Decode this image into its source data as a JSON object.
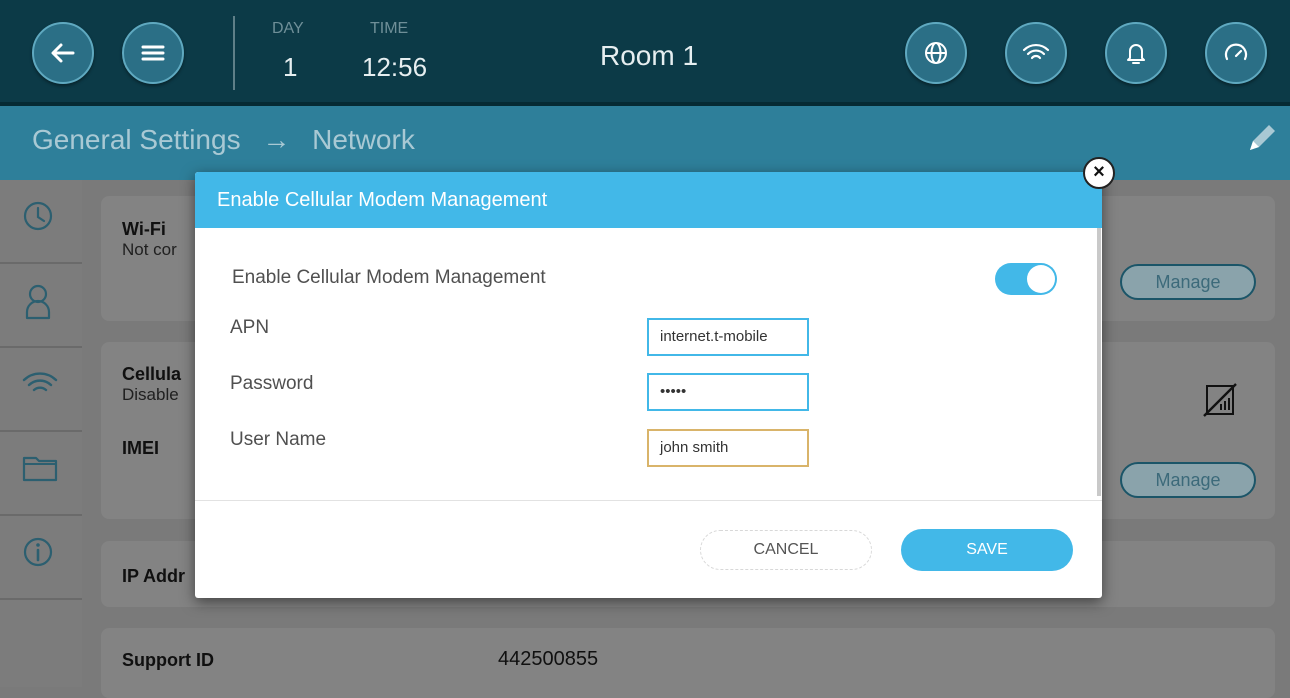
{
  "topbar": {
    "day_label": "DAY",
    "day_value": "1",
    "time_label": "TIME",
    "time_value": "12:56",
    "room_title": "Room 1",
    "buttons": [
      "back-arrow-icon",
      "menu-icon",
      "globe-icon",
      "wifi-icon",
      "bell-icon",
      "gauge-icon"
    ]
  },
  "breadcrumb": {
    "parent": "General Settings",
    "arrow": "→",
    "current": "Network"
  },
  "sidebar": {
    "items": [
      "clock-icon",
      "user-icon",
      "wifi-icon",
      "folder-icon",
      "info-icon"
    ]
  },
  "background_cards": {
    "wifi": {
      "title": "Wi-Fi",
      "status": "Not cor",
      "manage": "Manage"
    },
    "cellular": {
      "title": "Cellula",
      "status": "Disable",
      "imei_label": "IMEI",
      "manage": "Manage"
    },
    "ip": {
      "title": "IP Addr"
    },
    "support": {
      "title": "Support ID",
      "value": "442500855"
    }
  },
  "modal": {
    "title": "Enable Cellular Modem Management",
    "enable_label": "Enable Cellular Modem Management",
    "enable_state": true,
    "apn_label": "APN",
    "apn_value": "internet.t-mobile",
    "password_label": "Password",
    "password_value": "•••••",
    "username_label": "User Name",
    "username_value": "john smith",
    "cancel_label": "CANCEL",
    "save_label": "SAVE",
    "close_label": "×"
  },
  "colors": {
    "topbar": "#0c3a47",
    "subbar": "#2e7f9a",
    "accent": "#42b8e8",
    "active_field_border": "#d9b46a"
  }
}
